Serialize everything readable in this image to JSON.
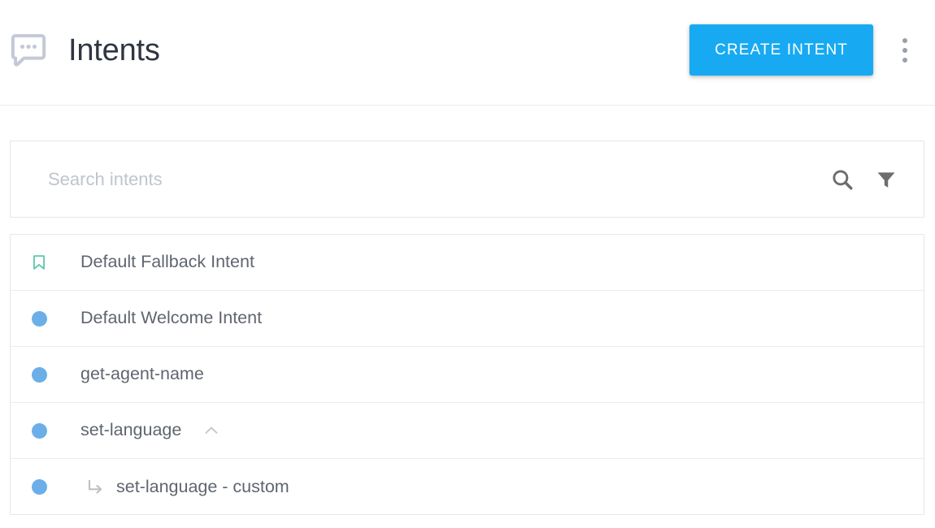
{
  "header": {
    "icon": "chat-bubble-dots-icon",
    "title": "Intents",
    "create_button_label": "CREATE INTENT",
    "overflow_menu": "more-options-icon",
    "accent_color": "#17aaf2",
    "title_color": "#2f3541",
    "icon_color": "#c3c9d6"
  },
  "search": {
    "placeholder": "Search intents",
    "value": "",
    "search_icon": "search-icon",
    "filter_icon": "filter-icon",
    "icon_color": "#6d6d6d"
  },
  "list": {
    "marker_colors": {
      "bookmark": "#5ec8aa",
      "dot": "#6cafe8",
      "arrow": "#bdc1c6",
      "chevron": "#c5cad2"
    },
    "rows": [
      {
        "label": "Default Fallback Intent",
        "marker": "bookmark-icon",
        "child": false,
        "expanded": null
      },
      {
        "label": "Default Welcome Intent",
        "marker": "dot",
        "child": false,
        "expanded": null
      },
      {
        "label": "get-agent-name",
        "marker": "dot",
        "child": false,
        "expanded": null
      },
      {
        "label": "set-language",
        "marker": "dot",
        "child": false,
        "expanded": "chevron-up-icon"
      },
      {
        "label": "set-language - custom",
        "marker": "dot",
        "child": true,
        "expanded": null
      }
    ]
  }
}
